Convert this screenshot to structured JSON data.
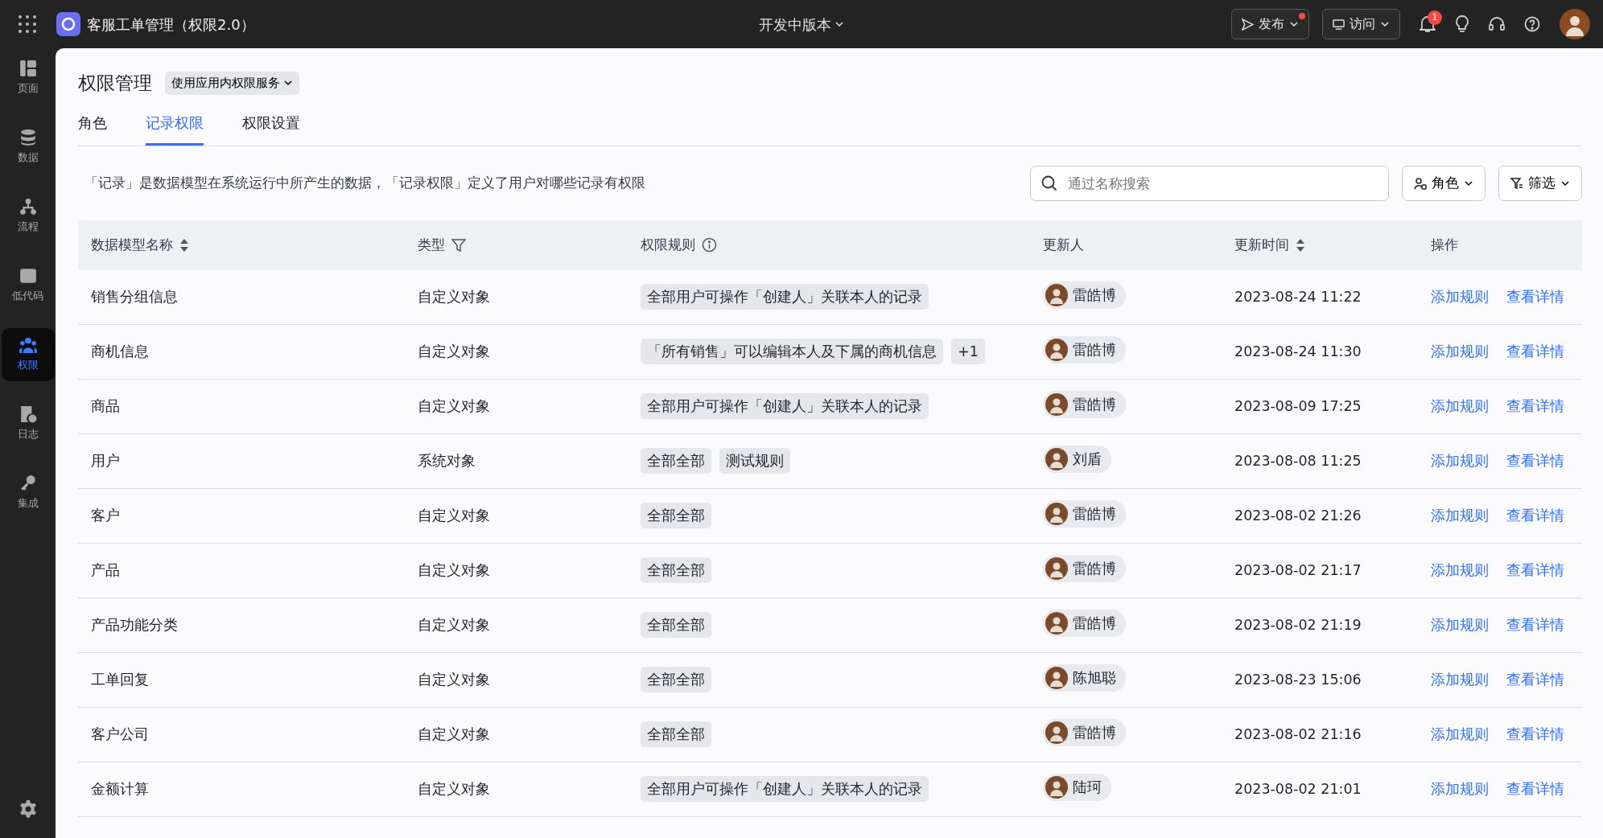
{
  "app": {
    "title": "客服工单管理（权限2.0）",
    "version": "开发中版本",
    "publish": "发布",
    "publish_dot": true,
    "visit": "访问",
    "notifications": "1"
  },
  "sidebar": {
    "items": [
      {
        "label": "页面",
        "selected": false
      },
      {
        "label": "数据",
        "selected": false
      },
      {
        "label": "流程",
        "selected": false
      },
      {
        "label": "低代码",
        "selected": false
      },
      {
        "label": "权限",
        "selected": true
      },
      {
        "label": "日志",
        "selected": false
      },
      {
        "label": "集成",
        "selected": false
      }
    ]
  },
  "page": {
    "title": "权限管理",
    "service": "使用应用内权限服务"
  },
  "tabs": [
    {
      "label": "角色",
      "selected": false
    },
    {
      "label": "记录权限",
      "selected": true
    },
    {
      "label": "权限设置",
      "selected": false
    }
  ],
  "description": "「记录」是数据模型在系统运行中所产生的数据，「记录权限」定义了用户对哪些记录有权限",
  "search": {
    "placeholder": "通过名称搜索"
  },
  "role_button": "角色",
  "filter_button": "筛选",
  "table": {
    "columns": [
      {
        "label": "数据模型名称",
        "kind": "sort"
      },
      {
        "label": "类型",
        "kind": "filter"
      },
      {
        "label": "权限规则",
        "kind": "info"
      },
      {
        "label": "更新人",
        "kind": "plain"
      },
      {
        "label": "更新时间",
        "kind": "sort"
      },
      {
        "label": "操作",
        "kind": "plain"
      }
    ],
    "rows": [
      {
        "name": "销售分组信息",
        "type": "自定义对象",
        "rules": [
          "全部用户可操作「创建人」关联本人的记录"
        ],
        "updater": "雷皓博",
        "time": "2023-08-24 11:22",
        "actions": [
          "添加规则",
          "查看详情"
        ]
      },
      {
        "name": "商机信息",
        "type": "自定义对象",
        "rules": [
          "「所有销售」可以编辑本人及下属的商机信息",
          "+1"
        ],
        "updater": "雷皓博",
        "time": "2023-08-24 11:30",
        "actions": [
          "添加规则",
          "查看详情"
        ]
      },
      {
        "name": "商品",
        "type": "自定义对象",
        "rules": [
          "全部用户可操作「创建人」关联本人的记录"
        ],
        "updater": "雷皓博",
        "time": "2023-08-09 17:25",
        "actions": [
          "添加规则",
          "查看详情"
        ]
      },
      {
        "name": "用户",
        "type": "系统对象",
        "rules": [
          "全部全部",
          "测试规则"
        ],
        "updater": "刘盾",
        "time": "2023-08-08 11:25",
        "actions": [
          "添加规则",
          "查看详情"
        ]
      },
      {
        "name": "客户",
        "type": "自定义对象",
        "rules": [
          "全部全部"
        ],
        "updater": "雷皓博",
        "time": "2023-08-02 21:26",
        "actions": [
          "添加规则",
          "查看详情"
        ]
      },
      {
        "name": "产品",
        "type": "自定义对象",
        "rules": [
          "全部全部"
        ],
        "updater": "雷皓博",
        "time": "2023-08-02 21:17",
        "actions": [
          "添加规则",
          "查看详情"
        ]
      },
      {
        "name": "产品功能分类",
        "type": "自定义对象",
        "rules": [
          "全部全部"
        ],
        "updater": "雷皓博",
        "time": "2023-08-02 21:19",
        "actions": [
          "添加规则",
          "查看详情"
        ]
      },
      {
        "name": "工单回复",
        "type": "自定义对象",
        "rules": [
          "全部全部"
        ],
        "updater": "陈旭聪",
        "time": "2023-08-23 15:06",
        "actions": [
          "添加规则",
          "查看详情"
        ]
      },
      {
        "name": "客户公司",
        "type": "自定义对象",
        "rules": [
          "全部全部"
        ],
        "updater": "雷皓博",
        "time": "2023-08-02 21:16",
        "actions": [
          "添加规则",
          "查看详情"
        ]
      },
      {
        "name": "金额计算",
        "type": "自定义对象",
        "rules": [
          "全部用户可操作「创建人」关联本人的记录"
        ],
        "updater": "陆珂",
        "time": "2023-08-02 21:01",
        "actions": [
          "添加规则",
          "查看详情"
        ]
      }
    ]
  }
}
